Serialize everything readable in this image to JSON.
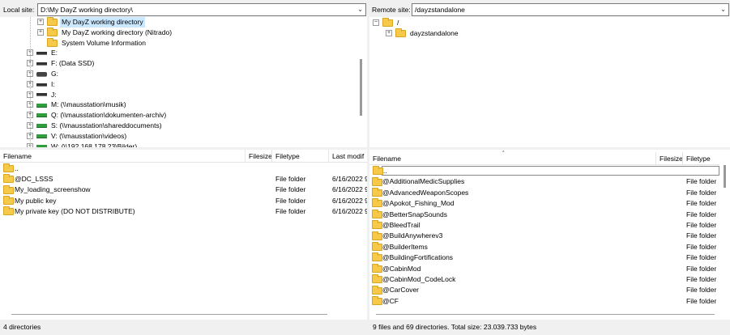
{
  "local_site": {
    "label": "Local site:",
    "path": "D:\\My DayZ working directory\\"
  },
  "remote_site": {
    "label": "Remote site:",
    "path": "/dayzstandalone"
  },
  "local_tree": [
    {
      "label": "My DayZ working directory",
      "kind": "folder",
      "expander": "+",
      "selected": true
    },
    {
      "label": "My DayZ working directory (Nitrado)",
      "kind": "folder",
      "expander": "+"
    },
    {
      "label": "System Volume Information",
      "kind": "folder",
      "expander": ""
    },
    {
      "label": "E:",
      "kind": "drive",
      "expander": "+"
    },
    {
      "label": "F: (Data SSD)",
      "kind": "drive",
      "expander": "+"
    },
    {
      "label": "G:",
      "kind": "dvd",
      "expander": "+"
    },
    {
      "label": "I:",
      "kind": "usb",
      "expander": "+"
    },
    {
      "label": "J:",
      "kind": "drive",
      "expander": "+"
    },
    {
      "label": "M: (\\\\mausstation\\musik)",
      "kind": "net",
      "expander": "+"
    },
    {
      "label": "Q: (\\\\mausstation\\dokumenten-archiv)",
      "kind": "net",
      "expander": "+"
    },
    {
      "label": "S: (\\\\mausstation\\shareddocuments)",
      "kind": "net",
      "expander": "+"
    },
    {
      "label": "V: (\\\\mausstation\\videos)",
      "kind": "net",
      "expander": "+"
    },
    {
      "label": "W: (\\\\192.168.178.23\\Bilder)",
      "kind": "net",
      "expander": "+"
    }
  ],
  "remote_tree": [
    {
      "label": "/",
      "expander": "−"
    },
    {
      "label": "dayzstandalone",
      "expander": "+"
    }
  ],
  "local_list": {
    "headers": [
      "Filename",
      "Filesize",
      "Filetype",
      "Last modif"
    ],
    "rows": [
      {
        "name": "..",
        "size": "",
        "type": "",
        "modified": ""
      },
      {
        "name": "@DC_LSSS",
        "size": "",
        "type": "File folder",
        "modified": "6/16/2022 9"
      },
      {
        "name": "My_loading_screenshow",
        "size": "",
        "type": "File folder",
        "modified": "6/16/2022 9"
      },
      {
        "name": "My public key",
        "size": "",
        "type": "File folder",
        "modified": "6/16/2022 9"
      },
      {
        "name": "My private key (DO NOT DISTRIBUTE)",
        "size": "",
        "type": "File folder",
        "modified": "6/16/2022 9"
      }
    ],
    "status": "4 directories"
  },
  "remote_list": {
    "headers": [
      "Filename",
      "Filesize",
      "Filetype"
    ],
    "rows": [
      {
        "name": "..",
        "type": ""
      },
      {
        "name": "@AdditionalMedicSupplies",
        "type": "File folder"
      },
      {
        "name": "@AdvancedWeaponScopes",
        "type": "File folder"
      },
      {
        "name": "@Apokot_Fishing_Mod",
        "type": "File folder"
      },
      {
        "name": "@BetterSnapSounds",
        "type": "File folder"
      },
      {
        "name": "@BleedTrail",
        "type": "File folder"
      },
      {
        "name": "@BuildAnywherev3",
        "type": "File folder"
      },
      {
        "name": "@BuilderItems",
        "type": "File folder"
      },
      {
        "name": "@BuildingFortifications",
        "type": "File folder"
      },
      {
        "name": "@CabinMod",
        "type": "File folder"
      },
      {
        "name": "@CabinMod_CodeLock",
        "type": "File folder"
      },
      {
        "name": "@CarCover",
        "type": "File folder"
      },
      {
        "name": "@CF",
        "type": "File folder"
      }
    ],
    "status": "9 files and 69 directories. Total size: 23.039.733 bytes"
  },
  "colors": {
    "folder": "#f7c948",
    "selection": "#cce8ff",
    "network_drive": "#2e9e3a"
  }
}
